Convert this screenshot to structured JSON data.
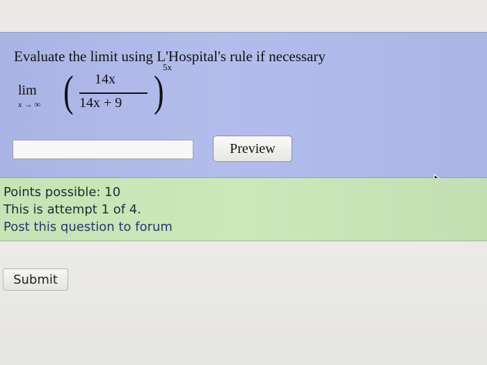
{
  "question": {
    "prompt": "Evaluate the limit using L'Hospital's rule if necessary",
    "expression": {
      "lim_word": "lim",
      "lim_subscript": "x → ∞",
      "numerator": "14x",
      "denominator": "14x + 9",
      "exponent": "5x"
    },
    "answer_input": {
      "value": "",
      "placeholder": ""
    },
    "preview_label": "Preview"
  },
  "info": {
    "points_possible": "Points possible: 10",
    "attempt": "This is attempt 1 of 4.",
    "forum_link": "Post this question to forum"
  },
  "submit_label": "Submit",
  "icons": {
    "pointer": "mouse-pointer-icon"
  },
  "colors": {
    "question_panel": "#aeb8e9",
    "info_panel": "#c8e6b8"
  }
}
